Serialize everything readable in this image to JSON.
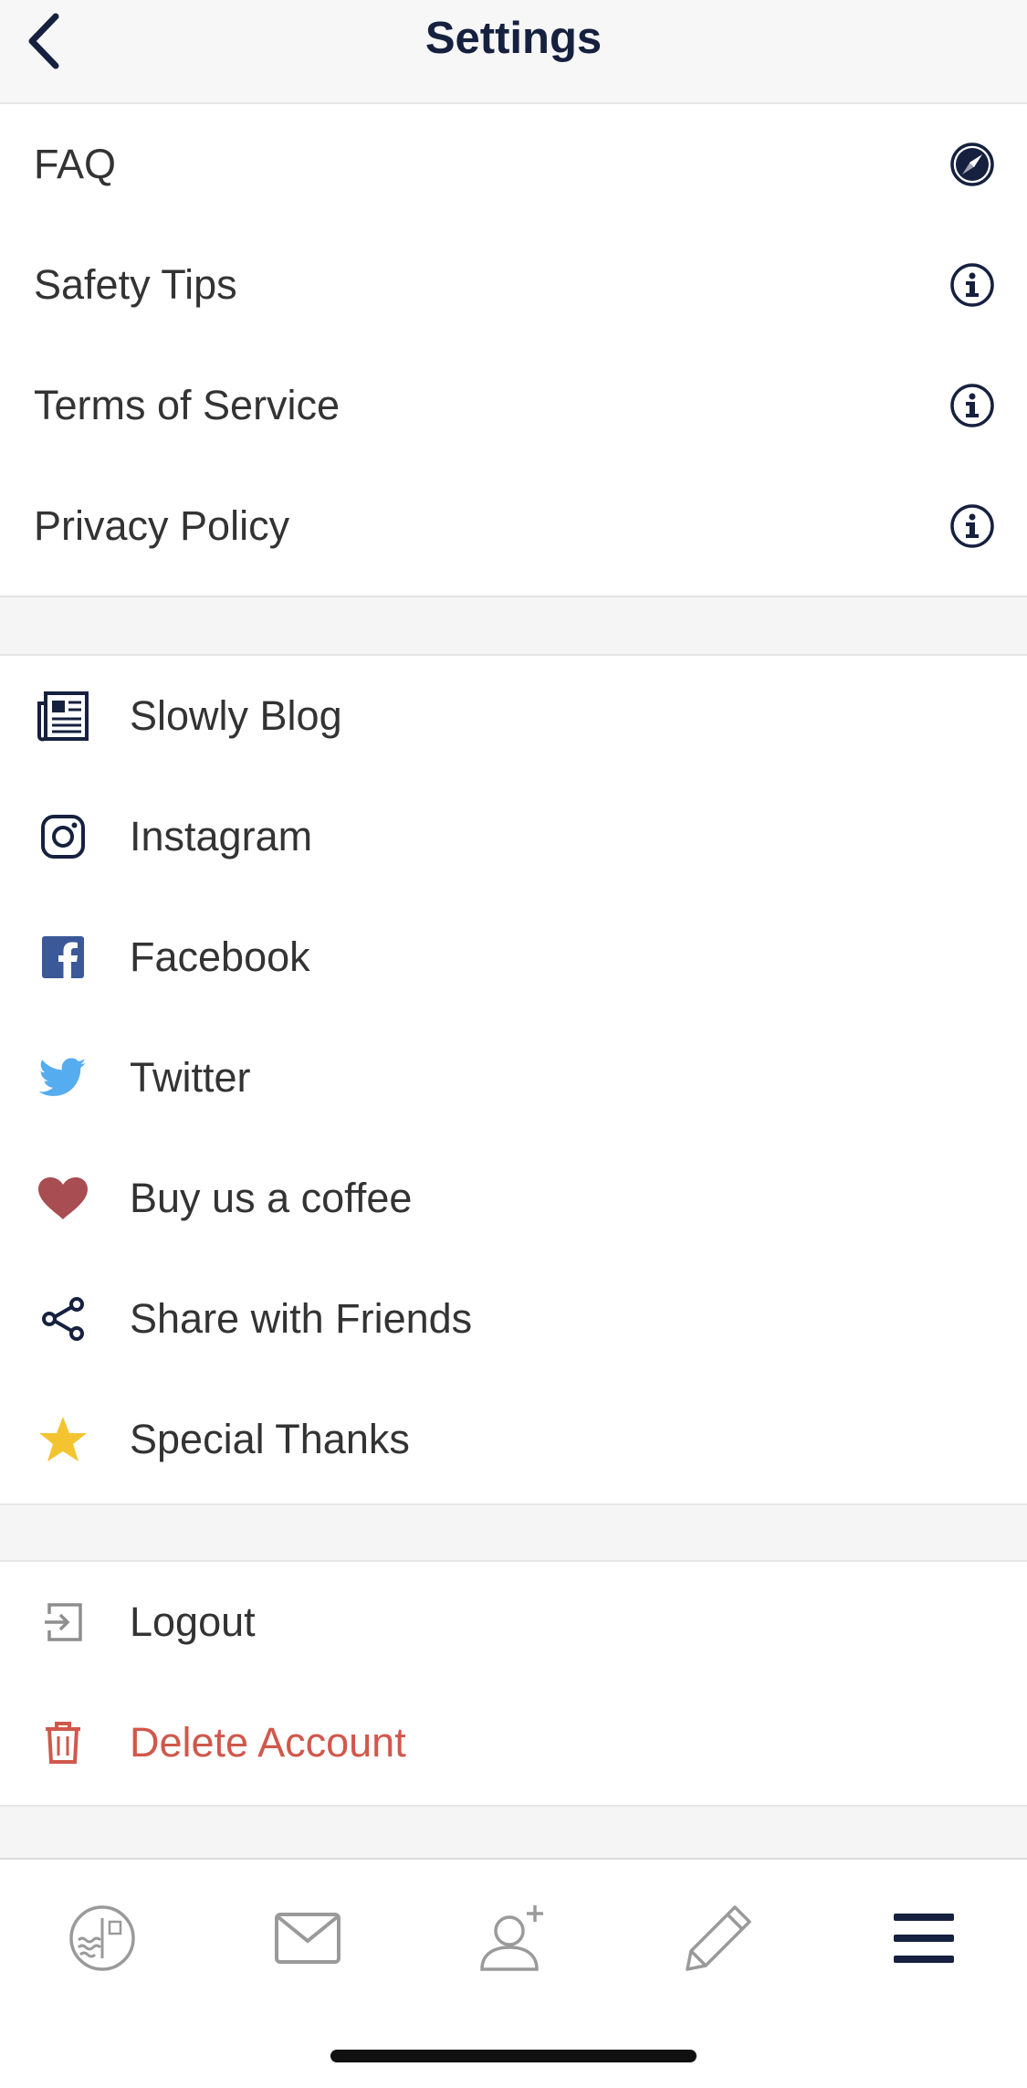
{
  "header": {
    "title": "Settings",
    "back_icon": "chevron-left-icon"
  },
  "info_items": [
    {
      "label": "FAQ",
      "icon": "compass-icon"
    },
    {
      "label": "Safety Tips",
      "icon": "info-icon"
    },
    {
      "label": "Terms of Service",
      "icon": "info-icon"
    },
    {
      "label": "Privacy Policy",
      "icon": "info-icon"
    }
  ],
  "link_items": [
    {
      "label": "Slowly Blog",
      "icon": "newspaper-icon"
    },
    {
      "label": "Instagram",
      "icon": "instagram-icon"
    },
    {
      "label": "Facebook",
      "icon": "facebook-icon"
    },
    {
      "label": "Twitter",
      "icon": "twitter-icon"
    },
    {
      "label": "Buy us a coffee",
      "icon": "heart-icon"
    },
    {
      "label": "Share with Friends",
      "icon": "share-icon"
    },
    {
      "label": "Special Thanks",
      "icon": "star-icon"
    }
  ],
  "account_items": [
    {
      "label": "Logout",
      "icon": "logout-icon"
    },
    {
      "label": "Delete Account",
      "icon": "trash-icon"
    }
  ],
  "tabbar": {
    "tabs": [
      "stamp-icon",
      "mail-icon",
      "add-friend-icon",
      "pencil-icon",
      "menu-icon"
    ],
    "active": "menu-icon"
  },
  "colors": {
    "navy": "#16213f",
    "danger": "#d0584b",
    "facebook": "#3b5998",
    "twitter": "#55acee",
    "heart": "#a84d52",
    "star": "#f4c430",
    "inactive_tab": "#9a9a9a"
  }
}
